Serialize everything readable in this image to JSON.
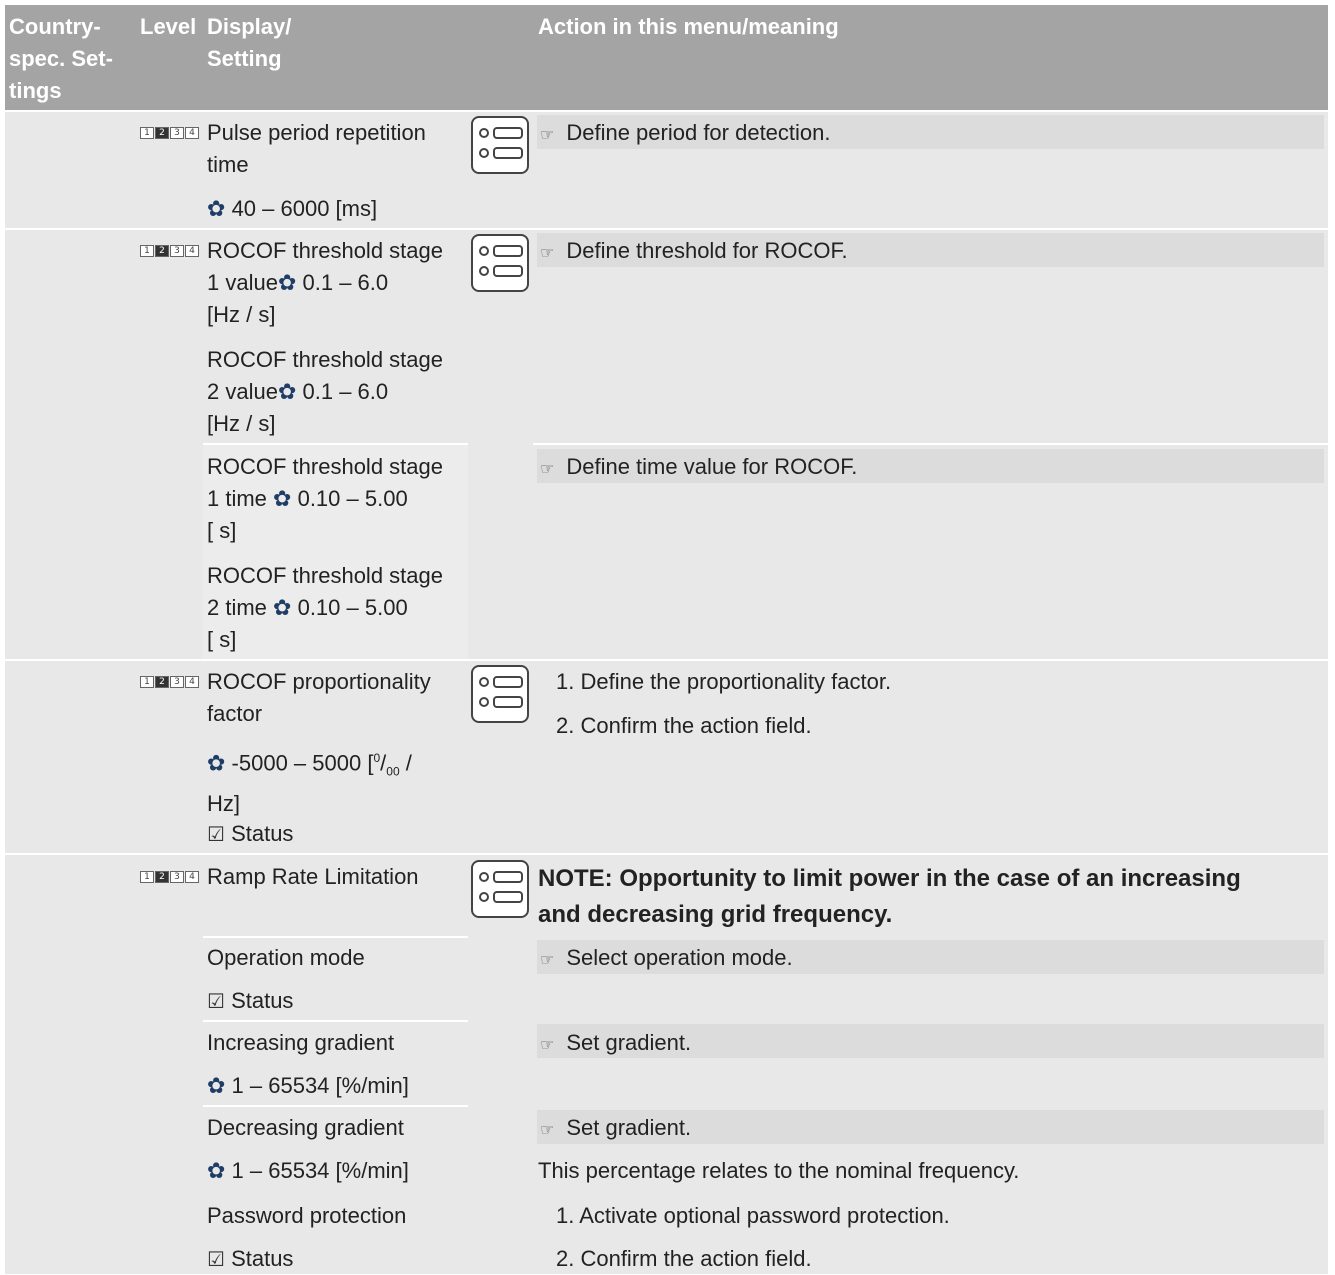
{
  "header": {
    "col_country": "Country-spec. Set-tings",
    "col_country_lines": [
      "Country-",
      "spec. Set-",
      "tings"
    ],
    "col_level": "Level",
    "col_display_lines": [
      "Display/",
      "Setting"
    ],
    "col_action": "Action in this menu/meaning"
  },
  "level_indicator": {
    "boxes": [
      "1",
      "2",
      "3",
      "4"
    ],
    "active": "2"
  },
  "icons": {
    "gear": "gear-icon",
    "hand": "pointing-hand-icon",
    "menu": "menu-list-icon",
    "status": "status-checklist-icon"
  },
  "rows": {
    "pulse": {
      "line1": "Pulse period repetition",
      "line2": "time",
      "range": "40 – 6000 [ms]",
      "action": "Define period for detection."
    },
    "rocof_threshold": {
      "s1v_l1": "ROCOF threshold stage",
      "s1v_l2a": "1 value",
      "s1v_l2b": " 0.1 – 6.0",
      "s1v_l3": "[Hz / s]",
      "s2v_l1": "ROCOF threshold stage",
      "s2v_l2a": "2 value",
      "s2v_l2b": " 0.1 – 6.0",
      "s2v_l3": "[Hz / s]",
      "action_value": "Define threshold for ROCOF.",
      "s1t_l1": "ROCOF threshold stage",
      "s1t_l2a": "1 time ",
      "s1t_l2b": " 0.10 – 5.00",
      "s1t_l3": "[ s]",
      "s2t_l1": "ROCOF threshold stage",
      "s2t_l2a": "2 time ",
      "s2t_l2b": " 0.10 – 5.00",
      "s2t_l3": "[ s]",
      "action_time": "Define time value for ROCOF."
    },
    "proportionality": {
      "line1": "ROCOF proportionality",
      "line2": "factor",
      "range_a": " -5000 – 5000 [",
      "sup": "0",
      "slash": "/",
      "sub": "00",
      "range_b": " /",
      "line4": "Hz]",
      "status": "Status",
      "step1": "1. Define the proportionality factor.",
      "step2": "2. Confirm the action field."
    },
    "ramp": {
      "title": "Ramp Rate Limitation",
      "note_l1": "NOTE: Opportunity to limit power in the case of an increasing",
      "note_l2": "and decreasing grid frequency.",
      "op_mode": "Operation mode",
      "op_status": "Status",
      "op_action": "Select operation mode.",
      "inc": "Increasing gradient",
      "inc_range": " 1 – 65534 [%/min]",
      "inc_action": "Set gradient.",
      "dec": "Decreasing gradient",
      "dec_range": " 1 – 65534 [%/min]",
      "dec_action": "Set gradient.",
      "nominal_note": "This percentage relates to the nominal frequency.",
      "pw": "Password protection",
      "pw_status": "Status",
      "pw_step1": "1. Activate optional password protection.",
      "pw_step2": "2. Confirm the action field."
    }
  }
}
